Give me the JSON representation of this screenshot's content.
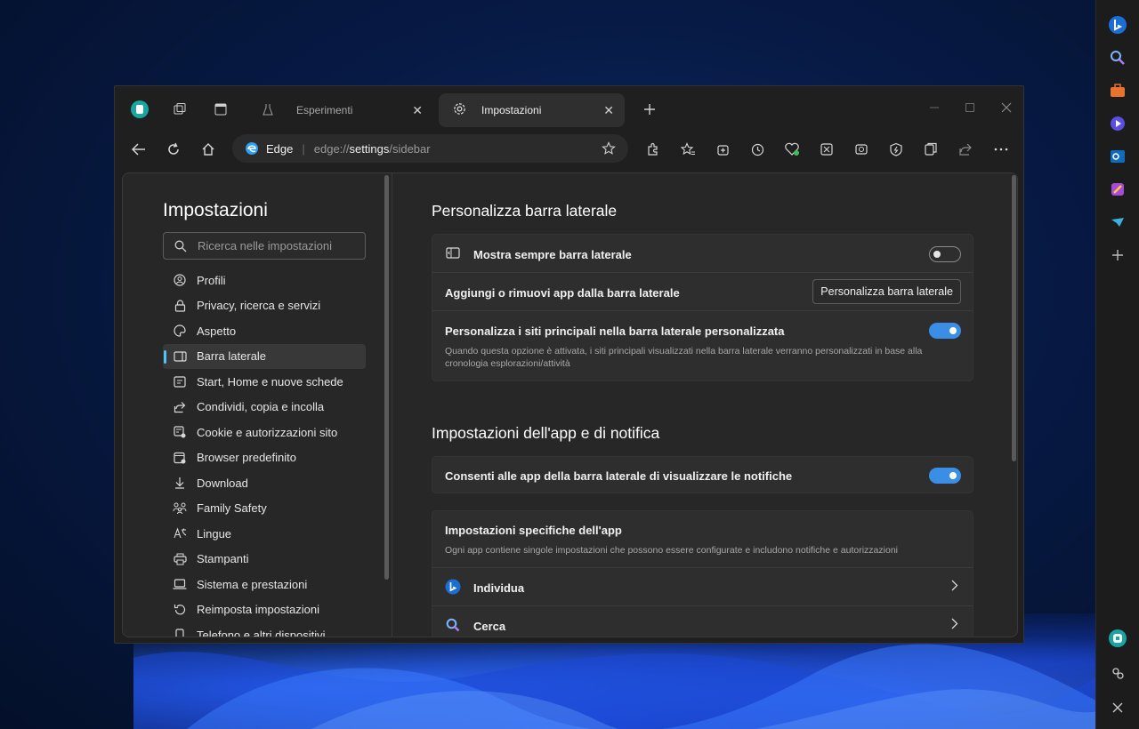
{
  "browser": {
    "tabs": [
      {
        "label": "Esperimenti",
        "active": false
      },
      {
        "label": "Impostazioni",
        "active": true
      }
    ],
    "address": {
      "site": "Edge",
      "url_prefix": "edge://",
      "url_path": "settings",
      "url_suffix": "/sidebar"
    }
  },
  "nav": {
    "title": "Impostazioni",
    "search_placeholder": "Ricerca nelle impostazioni",
    "items": [
      {
        "label": "Profili",
        "icon": "profile-icon"
      },
      {
        "label": "Privacy, ricerca e servizi",
        "icon": "lock-icon"
      },
      {
        "label": "Aspetto",
        "icon": "palette-icon"
      },
      {
        "label": "Barra laterale",
        "icon": "sidebar-icon",
        "selected": true
      },
      {
        "label": "Start, Home e nuove schede",
        "icon": "newtab-icon"
      },
      {
        "label": "Condividi, copia e incolla",
        "icon": "share-icon"
      },
      {
        "label": "Cookie e autorizzazioni sito",
        "icon": "cookie-icon"
      },
      {
        "label": "Browser predefinito",
        "icon": "browser-icon"
      },
      {
        "label": "Download",
        "icon": "download-icon"
      },
      {
        "label": "Family Safety",
        "icon": "family-icon"
      },
      {
        "label": "Lingue",
        "icon": "language-icon"
      },
      {
        "label": "Stampanti",
        "icon": "printer-icon"
      },
      {
        "label": "Sistema e prestazioni",
        "icon": "laptop-icon"
      },
      {
        "label": "Reimposta impostazioni",
        "icon": "reset-icon"
      },
      {
        "label": "Telefono e altri dispositivi",
        "icon": "phone-icon"
      }
    ]
  },
  "section1": {
    "title": "Personalizza barra laterale",
    "rows": {
      "always_show": {
        "label": "Mostra sempre barra laterale",
        "toggle": "off"
      },
      "add_remove": {
        "label": "Aggiungi o rimuovi app dalla barra laterale",
        "button": "Personalizza barra laterale"
      },
      "personalize_sites": {
        "label": "Personalizza i siti principali nella barra laterale personalizzata",
        "toggle": "on",
        "desc_line1": "Quando questa opzione è attivata, i siti principali visualizzati nella barra laterale verranno personalizzati in base alla",
        "desc_line2": "cronologia esplorazioni/attività"
      }
    }
  },
  "section2": {
    "title": "Impostazioni dell'app e di notifica",
    "notify": {
      "label": "Consenti alle app della barra laterale di visualizzare le notifiche",
      "toggle": "on"
    },
    "app_specific": {
      "title": "Impostazioni specifiche dell'app",
      "desc": "Ogni app contiene singole impostazioni che possono essere configurate e includono notifiche e autorizzazioni",
      "apps": [
        {
          "label": "Individua",
          "icon": "bing-icon"
        },
        {
          "label": "Cerca",
          "icon": "search-icon"
        }
      ]
    }
  },
  "colors": {
    "accent": "#3a8ee6",
    "selected_marker": "#4cc2ff"
  }
}
